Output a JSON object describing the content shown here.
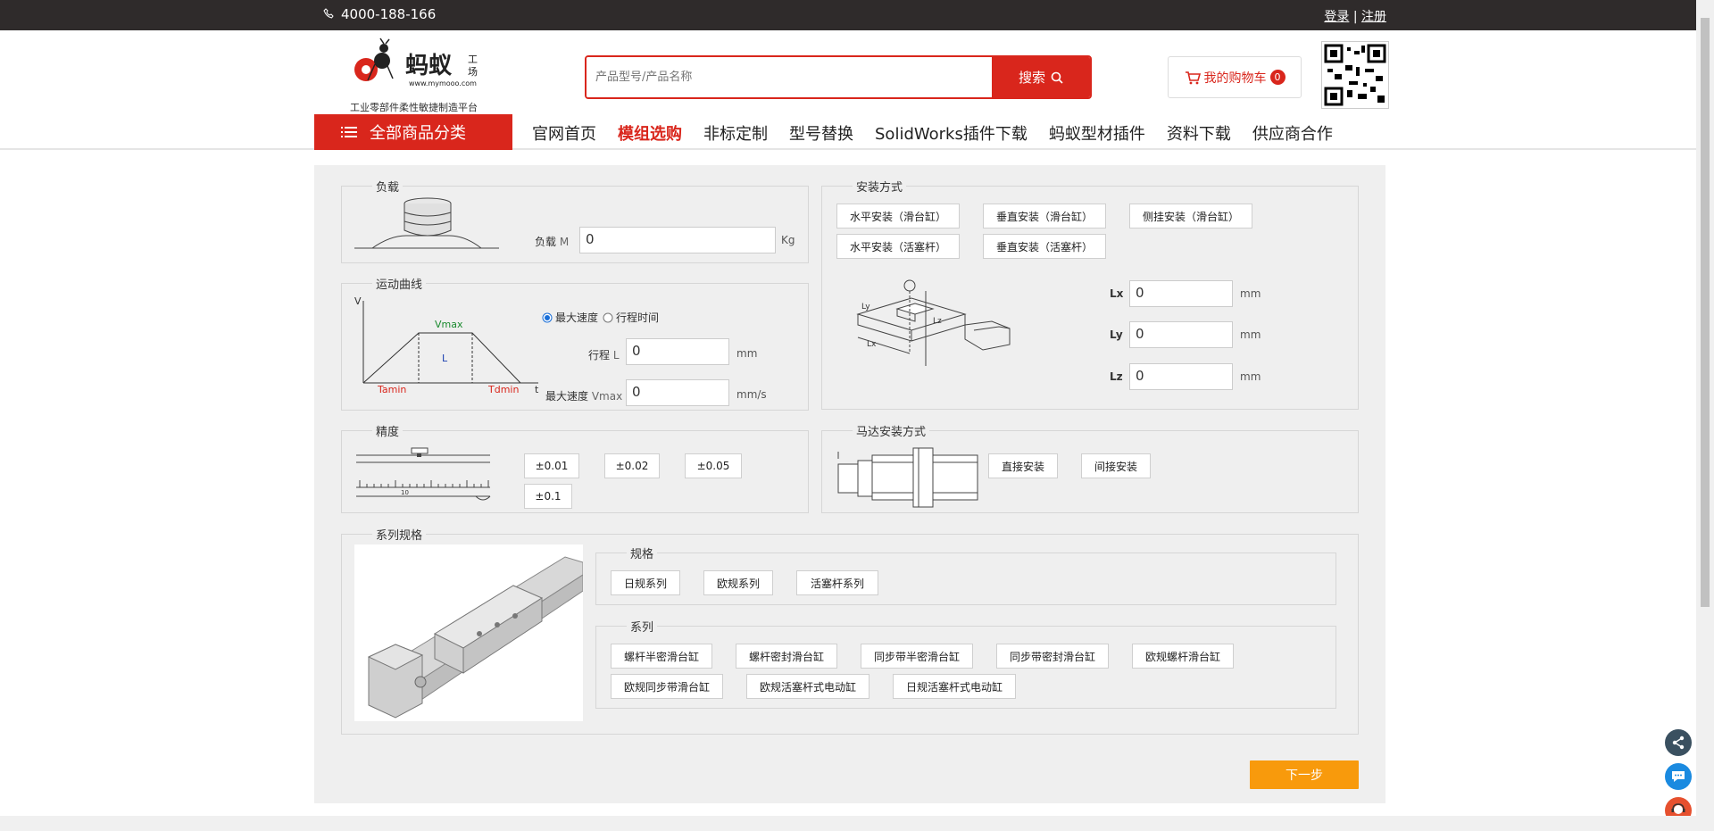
{
  "topbar": {
    "phone": "4000-188-166",
    "login": "登录",
    "separator": "|",
    "register": "注册"
  },
  "logo": {
    "tagline": "工业零部件柔性敏捷制造平台",
    "brand": "蚂蚁工场",
    "url": "www.mymooo.com"
  },
  "search": {
    "placeholder": "产品型号/产品名称",
    "button": "搜索"
  },
  "cart": {
    "label": "我的购物车",
    "count": "0"
  },
  "nav": {
    "all_categories": "全部商品分类",
    "links": [
      "官网首页",
      "模组选购",
      "非标定制",
      "型号替换",
      "SolidWorks插件下载",
      "蚂蚁型材插件",
      "资料下载",
      "供应商合作"
    ],
    "active_index": 1
  },
  "load": {
    "legend": "负载",
    "label": "负载",
    "symbol": "M",
    "value": "0",
    "unit": "Kg"
  },
  "mount": {
    "legend": "安装方式",
    "options": [
      "水平安装（滑台缸）",
      "垂直安装（滑台缸）",
      "侧挂安装（滑台缸）",
      "水平安装（活塞杆）",
      "垂直安装（活塞杆）"
    ],
    "fields": [
      {
        "label": "Lx",
        "value": "0",
        "unit": "mm"
      },
      {
        "label": "Ly",
        "value": "0",
        "unit": "mm"
      },
      {
        "label": "Lz",
        "value": "0",
        "unit": "mm"
      }
    ],
    "diagram_labels": {
      "lx": "Lx",
      "ly": "Ly",
      "lz": "Lz"
    }
  },
  "motion": {
    "legend": "运动曲线",
    "radio_max_speed": "最大速度",
    "radio_time": "行程时间",
    "stroke_label": "行程",
    "stroke_symbol": "L",
    "stroke_value": "0",
    "stroke_unit": "mm",
    "speed_label": "最大速度",
    "speed_symbol": "Vmax",
    "speed_value": "0",
    "speed_unit": "mm/s",
    "graph": {
      "v": "V",
      "vmax": "Vmax",
      "l": "L",
      "tamin": "Tamin",
      "tdmin": "Tdmin",
      "t": "t"
    }
  },
  "precision": {
    "legend": "精度",
    "options": [
      "±0.01",
      "±0.02",
      "±0.05",
      "±0.1"
    ],
    "scale_label": "10"
  },
  "motor": {
    "legend": "马达安装方式",
    "options": [
      "直接安装",
      "间接安装"
    ]
  },
  "series": {
    "legend": "系列规格",
    "spec_legend": "规格",
    "spec_options": [
      "日规系列",
      "欧规系列",
      "活塞杆系列"
    ],
    "series_legend": "系列",
    "series_options": [
      "螺杆半密滑台缸",
      "螺杆密封滑台缸",
      "同步带半密滑台缸",
      "同步带密封滑台缸",
      "欧规螺杆滑台缸",
      "欧规同步带滑台缸",
      "欧规活塞杆式电动缸",
      "日规活塞杆式电动缸"
    ]
  },
  "next_button": "下一步",
  "colors": {
    "brand_red": "#d9261c",
    "next_orange": "#f89a0c",
    "topbar": "#2f2b2b"
  }
}
